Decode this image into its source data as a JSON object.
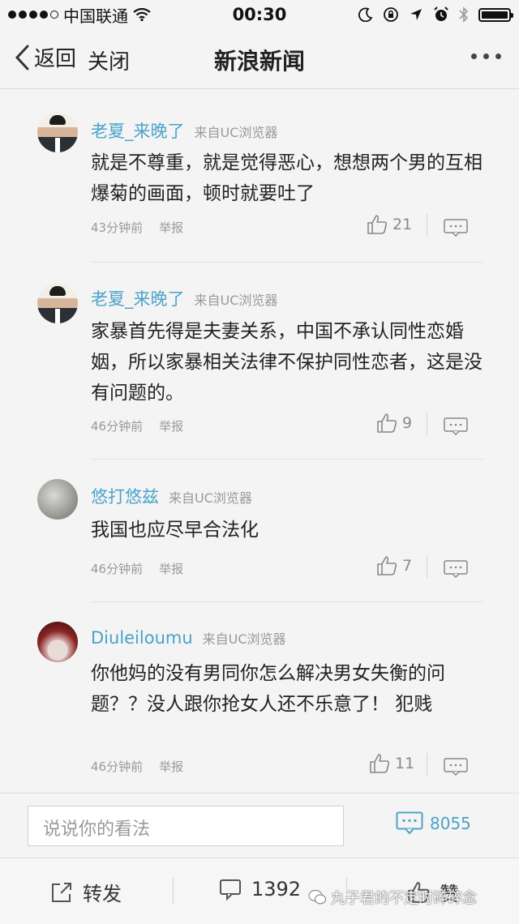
{
  "status_bar": {
    "carrier": "中国联通",
    "time": "00:30"
  },
  "nav": {
    "back_label": "返回",
    "close_label": "关闭",
    "title": "新浪新闻"
  },
  "comments": [
    {
      "username": "老夏_来晚了",
      "source": "来自UC浏览器",
      "text": "就是不尊重，就是觉得恶心，想想两个男的互相爆菊的画面，顿时就要吐了",
      "time": "43分钟前",
      "report": "举报",
      "likes": "21",
      "avatar": "person-avatar"
    },
    {
      "username": "老夏_来晚了",
      "source": "来自UC浏览器",
      "text": "家暴首先得是夫妻关系，中国不承认同性恋婚姻，所以家暴相关法律不保护同性恋者，这是没有问题的。",
      "time": "46分钟前",
      "report": "举报",
      "likes": "9",
      "avatar": "person-avatar"
    },
    {
      "username": "悠打悠兹",
      "source": "来自UC浏览器",
      "text": "我国也应尽早合法化",
      "time": "46分钟前",
      "report": "举报",
      "likes": "7",
      "avatar": "cloth-avatar"
    },
    {
      "username": "Diuleiloumu",
      "source": "来自UC浏览器",
      "text": "你他妈的没有男同你怎么解决男女失衡的问题？？没人跟你抢女人还不乐意了！ 犯贱",
      "time": "46分钟前",
      "report": "举报",
      "likes": "11",
      "avatar": "lips-avatar"
    }
  ],
  "input_bar": {
    "placeholder": "说说你的看法",
    "comment_count": "8055"
  },
  "bottom_bar": {
    "share_label": "转发",
    "comments_count": "1392",
    "like_label": "赞"
  },
  "watermark": "丸子君的不定时碎碎念",
  "colors": {
    "accent": "#4aa3c9",
    "background": "#f4f4f4"
  }
}
